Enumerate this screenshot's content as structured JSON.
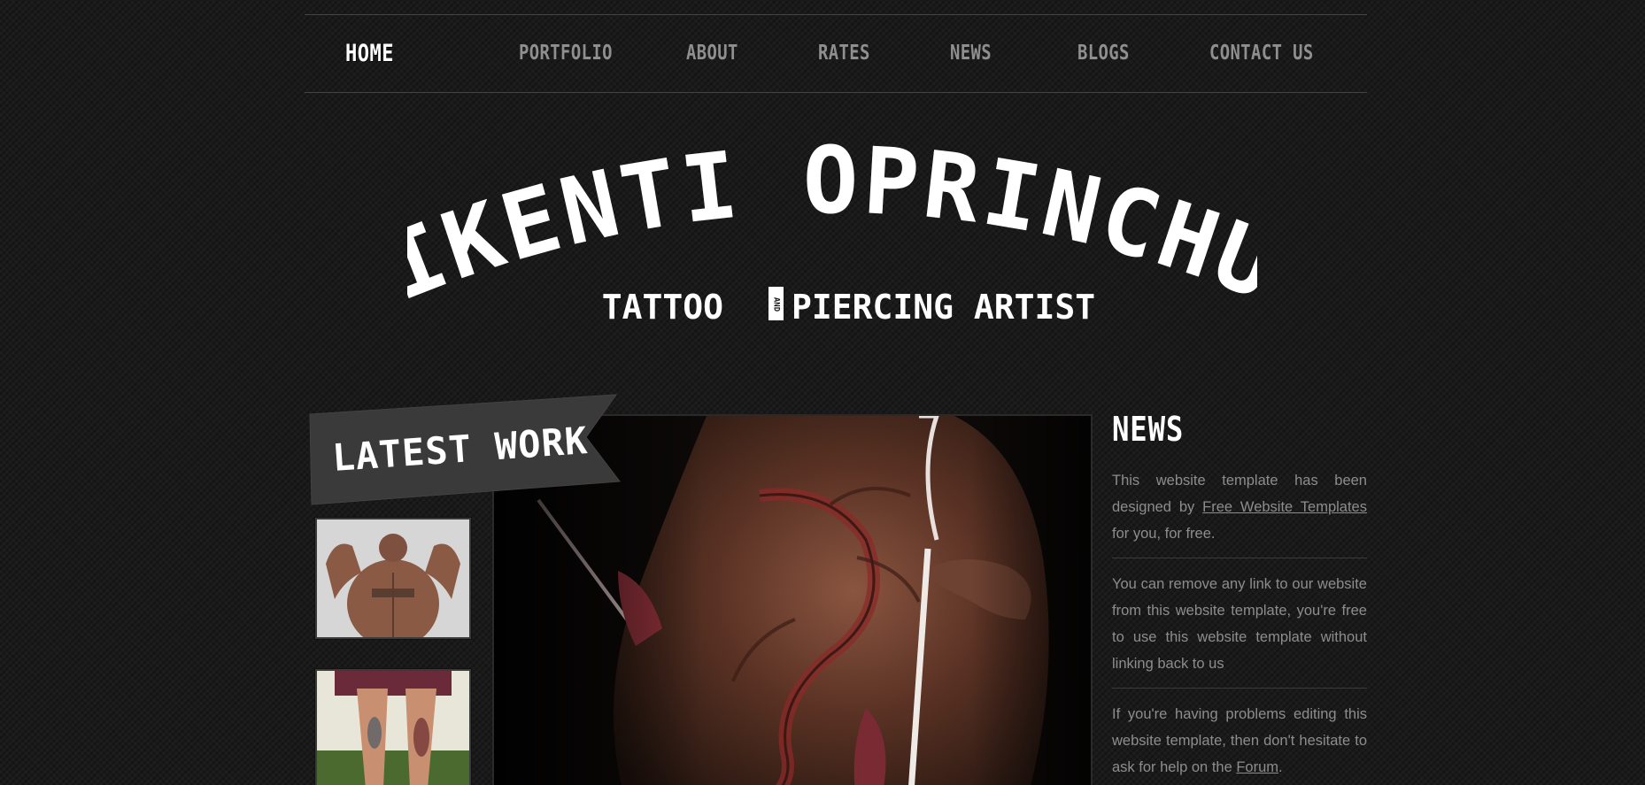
{
  "nav": {
    "items": [
      {
        "label": "HOME",
        "active": true
      },
      {
        "label": "PORTFOLIO"
      },
      {
        "label": "ABOUT"
      },
      {
        "label": "RATES"
      },
      {
        "label": "NEWS"
      },
      {
        "label": "BLOGS"
      },
      {
        "label": "CONTACT US"
      }
    ]
  },
  "header": {
    "name": "VIKENTI OPRINCHUK",
    "subtitle_left": "TATTOO",
    "subtitle_and": "AND",
    "subtitle_right": "PIERCING ARTIST"
  },
  "latest_work": {
    "ribbon_label": "LATEST WORK"
  },
  "sidebar": {
    "title": "NEWS",
    "p1_before": "This website template has been designed by ",
    "p1_link": "Free Website Templates",
    "p1_after": " for you, for free.",
    "p2": "You can remove any link to our website from this website template, you're free to use this website template without linking back to us",
    "p3_before": "If you're having problems editing this website template, then don't hesitate to ask for help on the ",
    "p3_link": "Forum",
    "p3_after": "."
  },
  "colors": {
    "background": "#1a1a1a",
    "nav_text": "#8f8f8f",
    "nav_active": "#ffffff",
    "body_text": "#8d8d8d",
    "ribbon": "#3a3a3a"
  }
}
